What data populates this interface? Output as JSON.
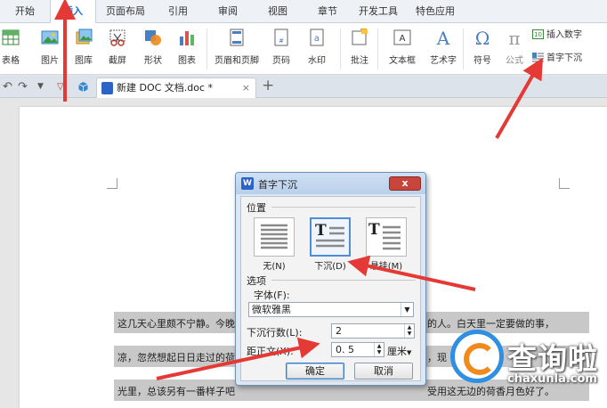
{
  "tabs": [
    "开始",
    "插入",
    "页面布局",
    "引用",
    "审阅",
    "视图",
    "章节",
    "开发工具",
    "特色应用"
  ],
  "active_tab": "插入",
  "ribbon": {
    "table": "表格",
    "picture": "图片",
    "gallery": "图库",
    "screenshot": "截屏",
    "shapes": "形状",
    "chart": "图表",
    "header_footer": "页眉和页脚",
    "page_number": "页码",
    "watermark": "水印",
    "comment": "批注",
    "textbox": "文本框",
    "wordart": "艺术字",
    "symbol": "符号",
    "formula": "公式",
    "insert_number": "插入数字",
    "drop_cap": "首字下沉"
  },
  "document_tab": {
    "title": "新建 DOC 文档.doc *",
    "close": "×"
  },
  "body_lines": [
    "这几天心里颇不宁静。今晚",
    "的人。白天里一定要做的事，",
    "凉，忽然想起日日走过的荷",
    "，现",
    "光里，总该另有一番样子吧",
    "受用这无边的荷香月色好了。"
  ],
  "dialog": {
    "title": "首字下沉",
    "close_symbol": "x",
    "position_label": "位置",
    "options": [
      "无(N)",
      "下沉(D)",
      "悬挂(M)"
    ],
    "selected_option": "下沉(D)",
    "options_section": "选项",
    "font_label": "字体(F):",
    "font_value": "微软雅黑",
    "lines_label": "下沉行数(L):",
    "lines_value": "2",
    "distance_label": "距正文(X):",
    "distance_value": "0. 5",
    "distance_unit": "厘米",
    "ok": "确定",
    "cancel": "取消"
  },
  "watermark": {
    "name": "查询啦",
    "domain": "chaxunla.com"
  },
  "colors": {
    "arrow": "#e53935",
    "accent": "#1e6fd0",
    "selection": "#c8c8c8"
  }
}
